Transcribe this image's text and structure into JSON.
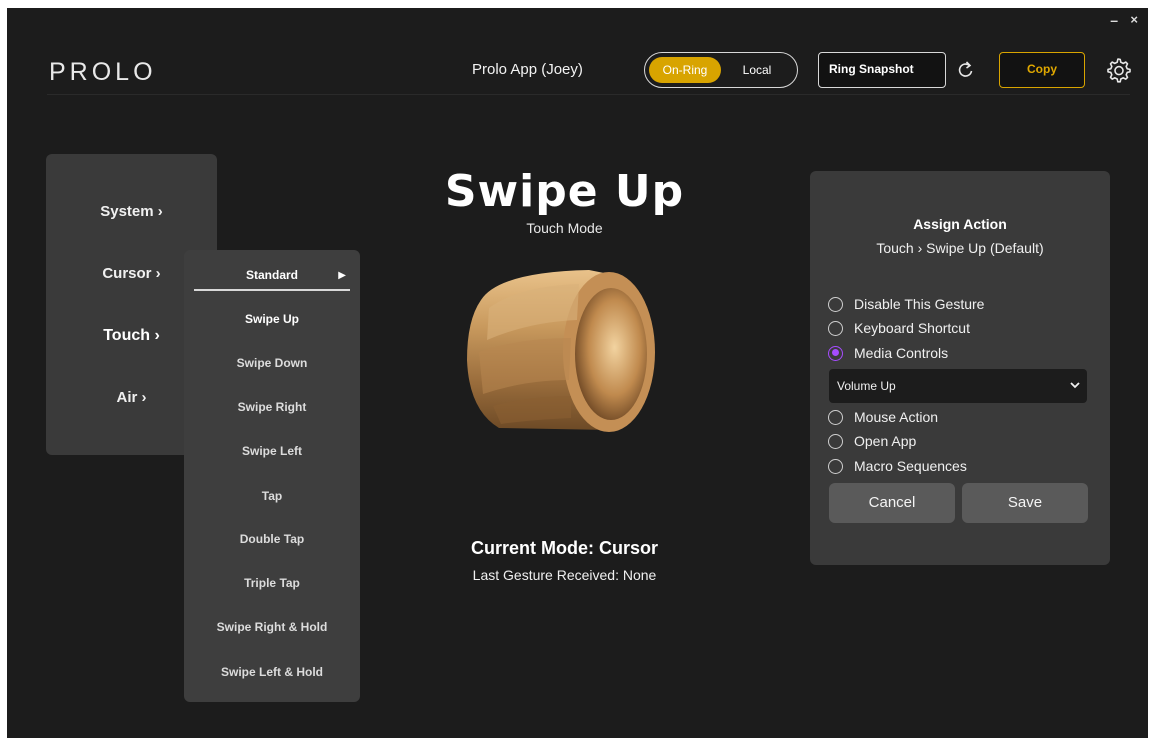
{
  "window": {
    "minimize_label": "–",
    "close_label": "×"
  },
  "header": {
    "logo": "PROLO",
    "app_title": "Prolo App  (Joey)",
    "mode_toggle": {
      "options": [
        "On-Ring",
        "Local"
      ],
      "active": "On-Ring"
    },
    "snapshot_label": "Ring Snapshot",
    "copy_label": "Copy",
    "icons": [
      "refresh-icon",
      "gear-icon"
    ]
  },
  "categories": [
    {
      "label": "System ›"
    },
    {
      "label": "Cursor ›"
    },
    {
      "label": "Touch ›",
      "active": true
    },
    {
      "label": "Air ›"
    }
  ],
  "submenu": {
    "header": "Standard",
    "header_arrow": "▶",
    "items": [
      "Swipe Up",
      "Swipe Down",
      "Swipe Right",
      "Swipe Left",
      "Tap",
      "Double Tap",
      "Triple Tap",
      "Swipe Right & Hold",
      "Swipe Left & Hold"
    ],
    "active": "Swipe Up"
  },
  "center": {
    "title": "Swipe Up",
    "subtitle": "Touch Mode",
    "current_mode": "Current Mode: Cursor",
    "last_gesture": "Last Gesture Received: None"
  },
  "assign": {
    "title": "Assign Action",
    "path": "Touch › Swipe Up (Default)",
    "options": [
      "Disable This Gesture",
      "Keyboard Shortcut",
      "Media Controls",
      "Mouse Action",
      "Open App",
      "Macro Sequences"
    ],
    "selected": "Media Controls",
    "media_select_value": "Volume Up",
    "cancel_label": "Cancel",
    "save_label": "Save"
  },
  "colors": {
    "accent_gold": "#d8a400",
    "radio_selected": "#a64cff",
    "background": "#1c1c1c",
    "panel": "#3a3a3a"
  }
}
